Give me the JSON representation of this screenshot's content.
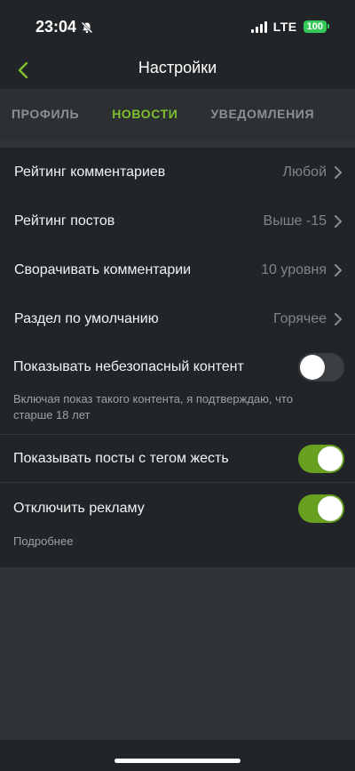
{
  "status_bar": {
    "time": "23:04",
    "network": "LTE",
    "battery": "100",
    "icons": {
      "silent": "bell-slash-icon",
      "signal": "signal-bars-icon"
    }
  },
  "nav": {
    "title": "Настройки",
    "back_icon": "chevron-left-icon"
  },
  "tabs": [
    {
      "label": "ПРОФИЛЬ",
      "active": false
    },
    {
      "label": "НОВОСТИ",
      "active": true
    },
    {
      "label": "УВЕДОМЛЕНИЯ",
      "active": false
    }
  ],
  "settings": {
    "comment_rating": {
      "label": "Рейтинг комментариев",
      "value": "Любой"
    },
    "post_rating": {
      "label": "Рейтинг постов",
      "value": "Выше -15"
    },
    "collapse_comments": {
      "label": "Сворачивать комментарии",
      "value": "10 уровня"
    },
    "default_section": {
      "label": "Раздел по умолчанию",
      "value": "Горячее"
    },
    "unsafe_content": {
      "label": "Показывать небезопасный контент",
      "hint": "Включая показ такого контента, я подтверждаю, что старше 18 лет",
      "enabled": false
    },
    "gore_posts": {
      "label": "Показывать посты с тегом жесть",
      "enabled": true
    },
    "disable_ads": {
      "label": "Отключить рекламу",
      "enabled": true,
      "more": "Подробнее"
    }
  },
  "colors": {
    "accent": "#7fbf2f",
    "toggle_on": "#68a121",
    "background": "#2f3336",
    "panel": "#222527"
  }
}
